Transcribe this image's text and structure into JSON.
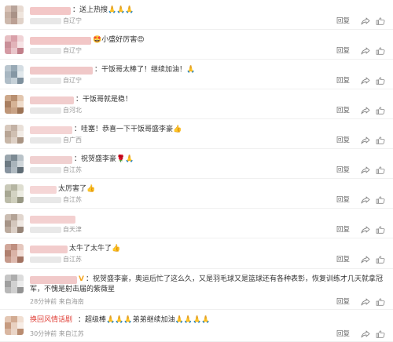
{
  "reply_label": "回复",
  "comments": [
    {
      "text": "：送上热搜🙏🙏🙏",
      "meta": "自辽宁",
      "name_color": "#f3c7c7"
    },
    {
      "text": "🤩小盛好厉害😍",
      "meta": "自辽宁",
      "name_color": "#f2c6c6"
    },
    {
      "text": "：干饭哥太棒了！继续加油！🙏",
      "meta": "自辽宁",
      "name_color": "#f0c8c8"
    },
    {
      "text": "：干饭哥就是稳！",
      "meta": "自河北",
      "name_color": "#f1cdcd"
    },
    {
      "text": "：哇塞！恭喜一下干饭哥盛李豪👍",
      "meta": "自广西",
      "name_color": "#f4d4d4"
    },
    {
      "text": "：祝贺盛李豪🌹🙏",
      "meta": "自江苏",
      "name_color": "#f0d0d0"
    },
    {
      "text": "太厉害了👍",
      "meta": "自江苏",
      "name_color": "#f5d6d6"
    },
    {
      "text": "",
      "meta": "自天津",
      "name_color": "#f3d0d0"
    },
    {
      "text": "太牛了太牛了👍",
      "meta": "自江苏",
      "name_color": "#f2cccc"
    },
    {
      "text": "：祝贺盛李豪，奥运后忙了这么久，又是羽毛球又是篮球还有各种表彰，恢复训练才几天就拿冠",
      "text2": "军，不愧是射击届的紫薇星",
      "meta": "28分钟前 来自海南",
      "name_color": "#f1c9c9",
      "vip": "V"
    },
    {
      "text": "：超级棒🙏🙏🙏弟弟继续加油🙏🙏🙏🙏",
      "meta": "30分钟前 来自江苏",
      "name": "换回风情话剧",
      "name_color": "#e0423a"
    }
  ]
}
